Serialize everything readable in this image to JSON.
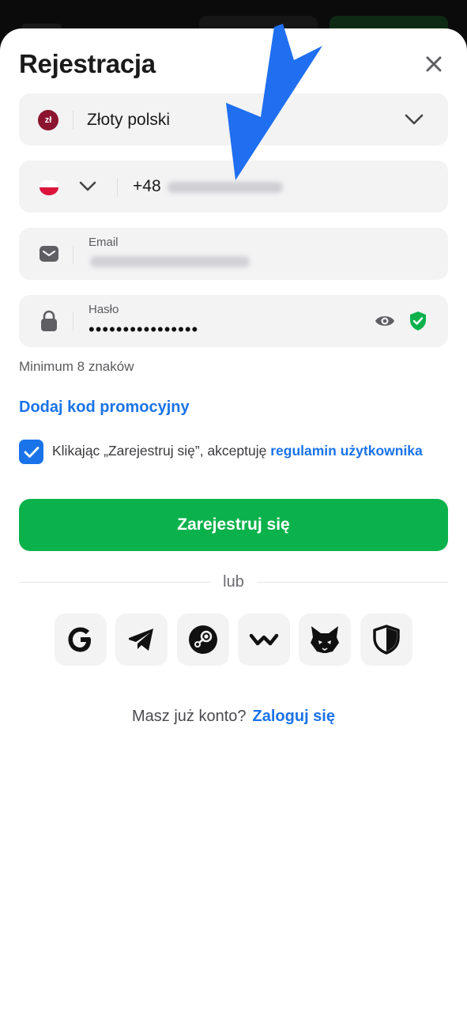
{
  "header": {
    "title": "Rejestracja"
  },
  "currency": {
    "badge": "zł",
    "label": "Złoty polski"
  },
  "phone": {
    "prefix": "+48"
  },
  "email": {
    "label": "Email"
  },
  "password": {
    "label": "Hasło",
    "masked_value": "••••••••••••••••",
    "hint": "Minimum 8 znaków"
  },
  "promo": {
    "label": "Dodaj kod promocyjny"
  },
  "terms": {
    "checked": true,
    "text": "Klikając „Zarejestruj się”, akceptuję",
    "link": "regulamin użytkownika"
  },
  "submit": {
    "label": "Zarejestruj się"
  },
  "divider": {
    "label": "lub"
  },
  "social": [
    "google-icon",
    "telegram-icon",
    "steam-icon",
    "walletconnect-icon",
    "metamask-fox-icon",
    "shield-icon"
  ],
  "footer": {
    "question": "Masz już konto?",
    "link": "Zaloguj się"
  },
  "colors": {
    "accent": "#1a73e8",
    "primary_button": "#0bb24c",
    "field_bg": "#f3f3f4",
    "secure_badge": "#0bb24c",
    "annotation_arrow": "#1f6ff0"
  },
  "icons": {
    "close": "close-icon",
    "chevron": "chevron-down-icon",
    "mail": "mail-icon",
    "lock": "lock-icon",
    "eye": "eye-icon",
    "check": "check-icon"
  }
}
